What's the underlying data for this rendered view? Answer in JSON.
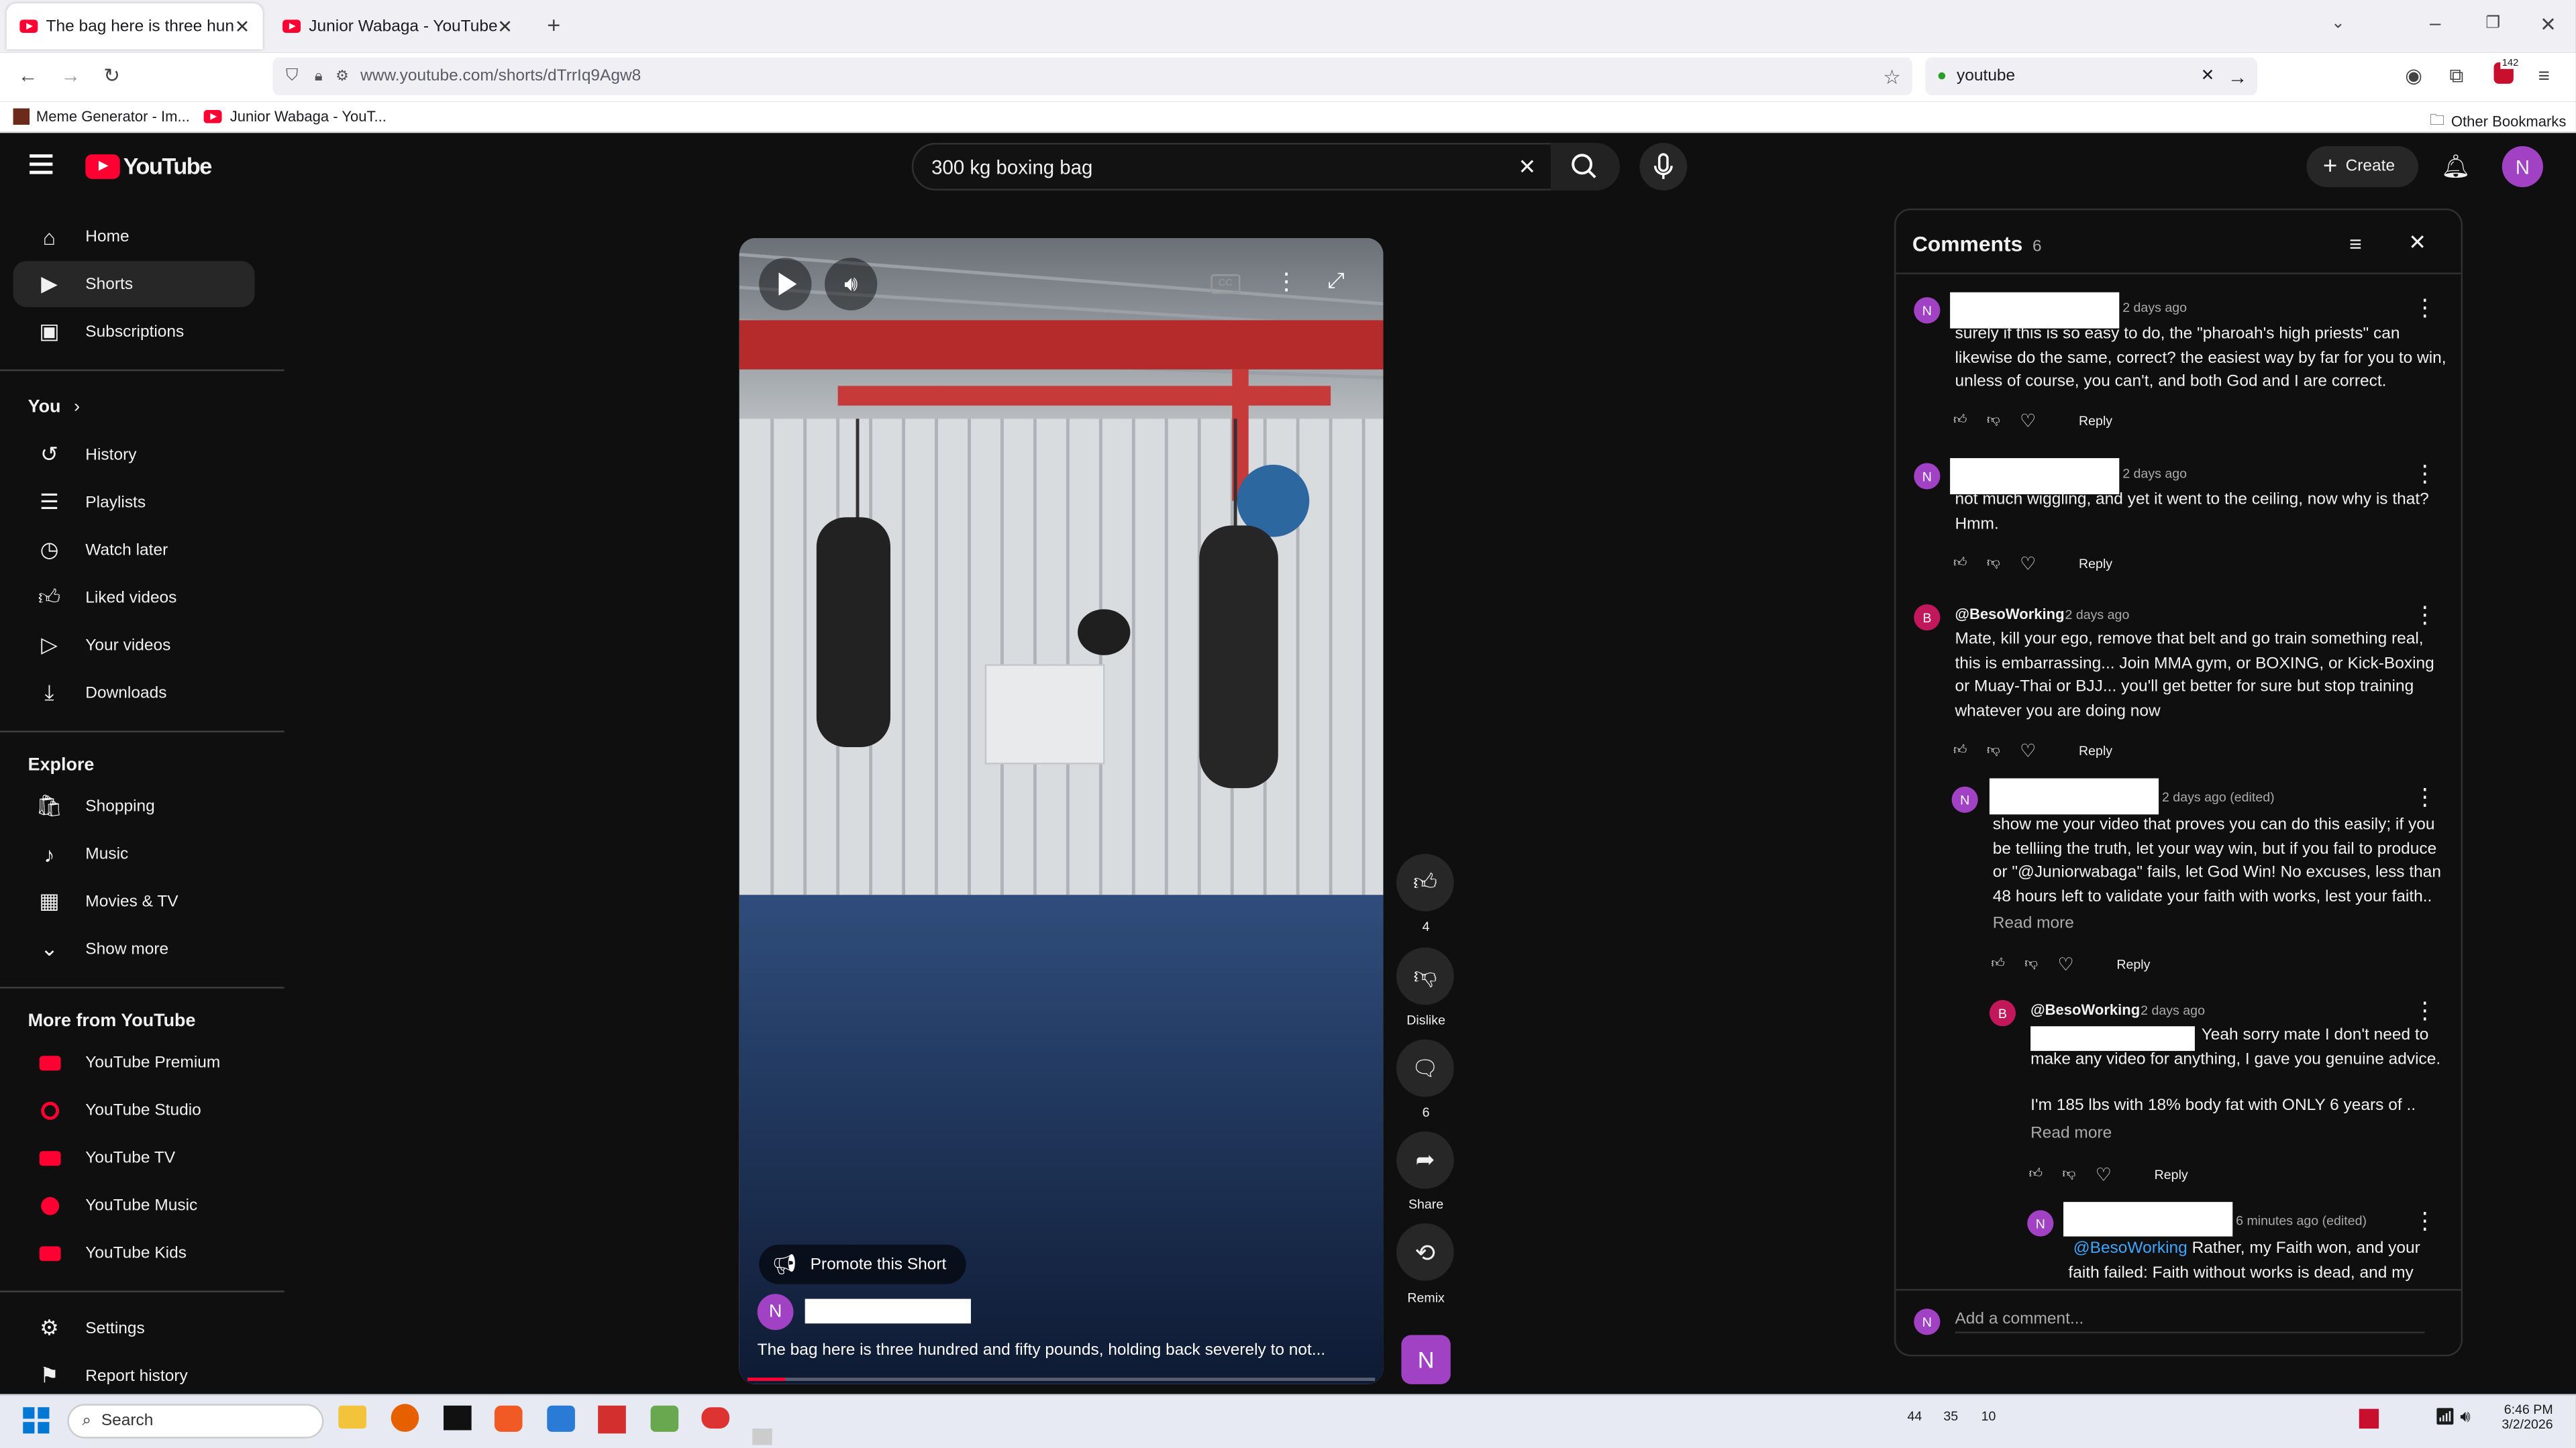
{
  "browser": {
    "tabs": [
      {
        "title": "The bag here is three hundred a"
      },
      {
        "title": "Junior Wabaga - YouTube"
      }
    ],
    "url": "www.youtube.com/shorts/dTrrIq9Agw8",
    "search_value": "youtube",
    "bookmarks": [
      "Meme Generator - Im...",
      "Junior Wabaga - YouT..."
    ],
    "other_bookmarks": "Other Bookmarks",
    "extension_badge": "142"
  },
  "youtube": {
    "logo": "YouTube",
    "search_query": "300 kg boxing bag",
    "create_label": "Create",
    "avatar_letter": "N"
  },
  "sidebar": {
    "main": [
      {
        "label": "Home",
        "icon": "home-icon"
      },
      {
        "label": "Shorts",
        "icon": "shorts-icon"
      },
      {
        "label": "Subscriptions",
        "icon": "subscriptions-icon"
      }
    ],
    "you_header": "You",
    "you": [
      {
        "label": "History",
        "icon": "history-icon"
      },
      {
        "label": "Playlists",
        "icon": "playlists-icon"
      },
      {
        "label": "Watch later",
        "icon": "watch-later-icon"
      },
      {
        "label": "Liked videos",
        "icon": "liked-videos-icon"
      },
      {
        "label": "Your videos",
        "icon": "your-videos-icon"
      },
      {
        "label": "Downloads",
        "icon": "downloads-icon"
      }
    ],
    "explore_header": "Explore",
    "explore": [
      {
        "label": "Shopping",
        "icon": "shopping-icon"
      },
      {
        "label": "Music",
        "icon": "music-icon"
      },
      {
        "label": "Movies & TV",
        "icon": "movies-icon"
      },
      {
        "label": "Show more",
        "icon": "chevron-down-icon"
      }
    ],
    "more_header": "More from YouTube",
    "more": [
      {
        "label": "YouTube Premium"
      },
      {
        "label": "YouTube Studio"
      },
      {
        "label": "YouTube TV"
      },
      {
        "label": "YouTube Music"
      },
      {
        "label": "YouTube Kids"
      }
    ],
    "bottom": [
      {
        "label": "Settings",
        "icon": "settings-icon"
      },
      {
        "label": "Report history",
        "icon": "flag-icon"
      }
    ]
  },
  "short": {
    "promote_label": "Promote this Short",
    "channel_letter": "N",
    "title": "The bag here is three hundred and fifty pounds, holding back severely to not...",
    "like_count": "4",
    "dislike_label": "Dislike",
    "comment_count": "6",
    "share_label": "Share",
    "remix_label": "Remix",
    "progress": 0.06
  },
  "comments": {
    "title": "Comments",
    "count": "6",
    "reply_label": "Reply",
    "read_more": "Read more",
    "add_placeholder": "Add a comment...",
    "items": [
      {
        "author": "",
        "letter": "N",
        "time": "2 days ago",
        "text": "surely if this is so easy to do, the \"pharoah's high priests\" can likewise do the same, correct? the easiest way by far for you to win, unless of course, you can't, and both God and I are correct."
      },
      {
        "author": "",
        "letter": "N",
        "time": "2 days ago",
        "text": "not much wiggling, and yet it went to the ceiling, now why is that? Hmm."
      },
      {
        "author": "@BesoWorking",
        "letter": "B",
        "time": "2 days ago",
        "text": "Mate, kill your ego, remove that belt and go train something real, this is embarrassing... Join MMA gym, or BOXING, or Kick-Boxing or Muay-Thai or BJJ... you'll get better for sure but stop training whatever you are doing now"
      },
      {
        "author": "",
        "letter": "N",
        "time": "2 days ago (edited)",
        "text": "show me your video that proves you can do this easily; if you be telliing the truth, let your way win, but if you fail to produce or \"@Juniorwabaga\" fails, let God Win! No excuses, less than 48 hours left to validate your faith with works, lest your faith.."
      },
      {
        "author": "@BesoWorking",
        "letter": "B",
        "time": "2 days ago",
        "text": "Yeah sorry mate I don't need to make any video for anything, I gave you genuine advice.",
        "text2": "I'm 185 lbs with 18% body fat  with ONLY 6 years of .."
      },
      {
        "author": "",
        "letter": "N",
        "time": "6 minutes ago (edited)",
        "mention": "@BesoWorking",
        "text": " Rather, my Faith won, and your faith failed: Faith without works is dead, and my"
      }
    ]
  },
  "taskbar": {
    "search_placeholder": "Search",
    "tray_numbers": [
      "44",
      "35",
      "10"
    ],
    "time": "6:46 PM",
    "date": "3/2/2026"
  },
  "colors": {
    "accent": "#ff0033",
    "avatar": "#a142c5",
    "avatar_b": "#c2185b"
  }
}
